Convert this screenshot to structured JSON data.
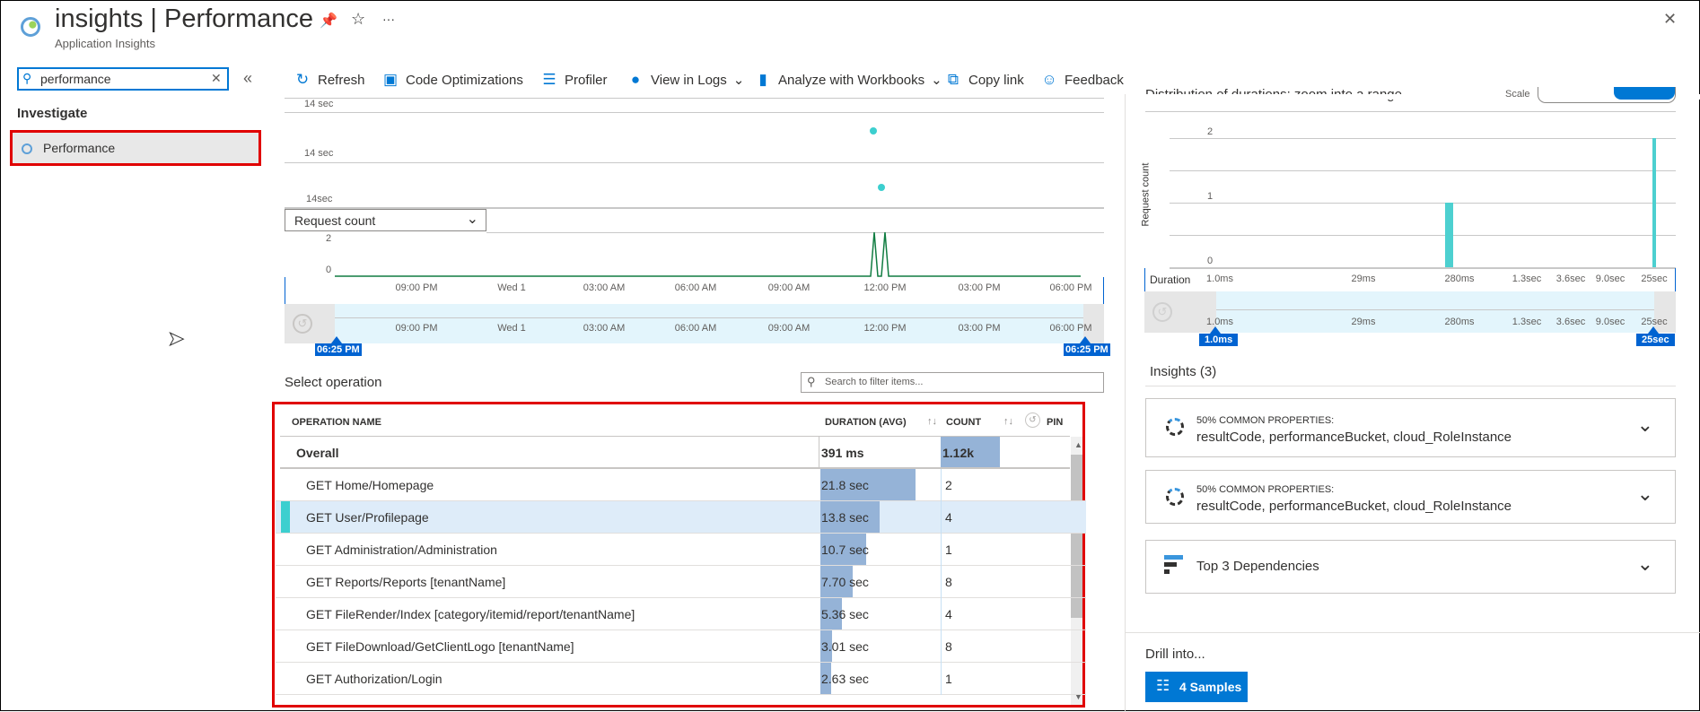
{
  "header": {
    "title": "insights | Performance",
    "subtitle": "Application Insights",
    "pin_icon": "pin-icon",
    "star_icon": "star-icon",
    "more": "···",
    "close": "✕"
  },
  "sidebar": {
    "search_value": "performance",
    "section": "Investigate",
    "item": "Performance",
    "collapse": "«"
  },
  "toolbar": {
    "refresh": "Refresh",
    "code_optimizations": "Code Optimizations",
    "profiler": "Profiler",
    "view_in_logs": "View in Logs",
    "analyze": "Analyze with Workbooks",
    "copy_link": "Copy link",
    "feedback": "Feedback"
  },
  "timeline": {
    "duration_labels": [
      "14 sec",
      "14 sec",
      "14sec"
    ],
    "metric_select": "Request count",
    "count_ticks": [
      "2",
      "0"
    ],
    "time_ticks": [
      "09:00 PM",
      "Wed 1",
      "03:00 AM",
      "06:00 AM",
      "09:00 AM",
      "12:00 PM",
      "03:00 PM",
      "06:00 PM"
    ],
    "range_start": "06:25 PM",
    "range_end": "06:25 PM"
  },
  "operations": {
    "title": "Select operation",
    "search_placeholder": "Search to filter items...",
    "columns": {
      "name": "OPERATION NAME",
      "duration": "DURATION (AVG)",
      "count": "COUNT",
      "pin": "PIN"
    },
    "overall": {
      "name": "Overall",
      "duration": "391 ms",
      "count": "1.12k",
      "count_fill": 0.55
    },
    "rows": [
      {
        "name": "GET Home/Homepage",
        "duration": "21.8 sec",
        "count": "2",
        "fill": 0.79
      },
      {
        "name": "GET User/Profilepage",
        "duration": "13.8 sec",
        "count": "4",
        "fill": 0.49,
        "selected": true
      },
      {
        "name": "GET Administration/Administration",
        "duration": "10.7 sec",
        "count": "1",
        "fill": 0.38
      },
      {
        "name": "GET Reports/Reports [tenantName]",
        "duration": "7.70 sec",
        "count": "8",
        "fill": 0.27
      },
      {
        "name": "GET FileRender/Index [category/itemid/report/tenantName]",
        "duration": "5.36 sec",
        "count": "4",
        "fill": 0.18
      },
      {
        "name": "GET FileDownload/GetClientLogo [tenantName]",
        "duration": "3.01 sec",
        "count": "8",
        "fill": 0.1
      },
      {
        "name": "GET Authorization/Login",
        "duration": "2.63 sec",
        "count": "1",
        "fill": 0.09
      }
    ]
  },
  "distribution": {
    "title": "Distribution of durations: zoom into a range",
    "scale_label": "Scale",
    "ylabel": "Request count",
    "yticks": [
      "2",
      "1",
      "0"
    ],
    "xlabel": "Duration",
    "xticks": [
      "1.0ms",
      "29ms",
      "280ms",
      "1.3sec",
      "3.6sec",
      "9.0sec",
      "25sec"
    ],
    "bars": [
      {
        "bucket": "280ms",
        "count": 1
      },
      {
        "bucket": "25sec",
        "count": 2
      }
    ],
    "range_start": "1.0ms",
    "range_end": "25sec",
    "bar_color": "#4dd0d0"
  },
  "insights": {
    "title": "Insights (3)",
    "cards": [
      {
        "key": "50% COMMON PROPERTIES:",
        "value": "resultCode, performanceBucket, cloud_RoleInstance"
      },
      {
        "key": "50% COMMON PROPERTIES:",
        "value": "resultCode, performanceBucket, cloud_RoleInstance"
      },
      {
        "key": "",
        "value": "Top 3 Dependencies"
      }
    ]
  },
  "drill": {
    "title": "Drill into...",
    "button": "4 Samples"
  },
  "colors": {
    "accent": "#0078d4",
    "highlight": "#e00000",
    "bar": "#95b3d7",
    "teal": "#3ccfcf"
  }
}
